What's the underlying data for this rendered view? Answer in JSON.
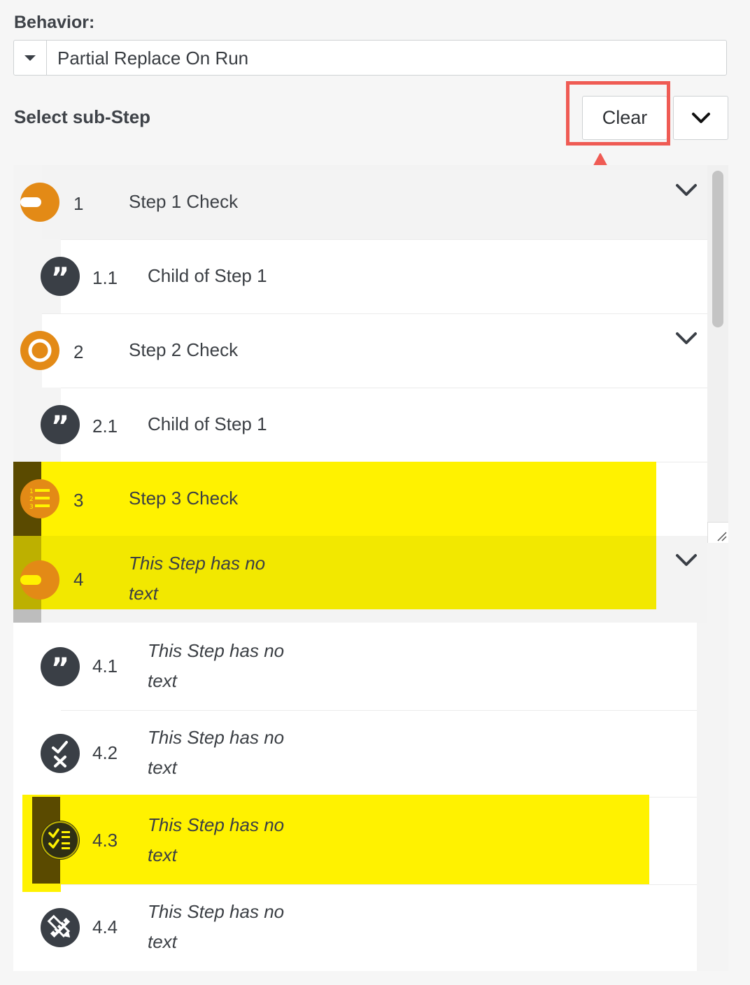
{
  "behavior": {
    "label": "Behavior:",
    "selected": "Partial Replace On Run"
  },
  "substep": {
    "label": "Select sub-Step",
    "clear_label": "Clear"
  },
  "colors": {
    "accent_orange": "#e38a16",
    "icon_dark": "#3a3f46",
    "highlight_yellow": "#fff200",
    "annotation_red": "#ef5b54"
  },
  "steps": [
    {
      "num": "1",
      "text": "Step 1 Check",
      "icon": "stop-icon",
      "expandable": true
    },
    {
      "num": "1.1",
      "text": "Child of Step 1",
      "icon": "quote-icon"
    },
    {
      "num": "2",
      "text": "Step 2 Check",
      "icon": "ring-icon",
      "expandable": true
    },
    {
      "num": "2.1",
      "text": "Child of Step 1",
      "icon": "quote-icon"
    },
    {
      "num": "3",
      "text": "Step 3 Check",
      "icon": "numbered-list-icon"
    },
    {
      "num": "4",
      "text_line1": "This Step has no",
      "text_line2": "text",
      "icon": "stop-icon",
      "expandable": true
    },
    {
      "num": "4.1",
      "text_line1": "This Step has no",
      "text_line2": "text",
      "icon": "quote-icon"
    },
    {
      "num": "4.2",
      "text_line1": "This Step has no",
      "text_line2": "text",
      "icon": "check-x-icon"
    },
    {
      "num": "4.3",
      "text_line1": "This Step has no",
      "text_line2": "text",
      "icon": "checklist-icon"
    },
    {
      "num": "4.4",
      "text_line1": "This Step has no",
      "text_line2": "text",
      "icon": "pencil-ruler-icon"
    }
  ]
}
